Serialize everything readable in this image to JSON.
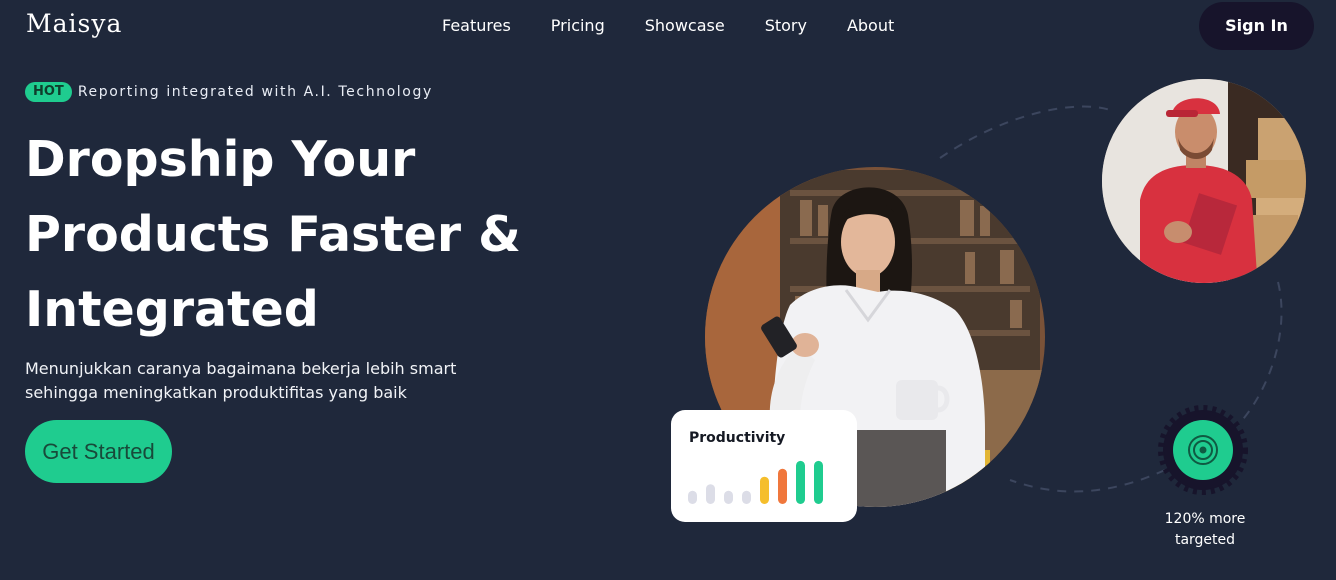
{
  "brand": {
    "logo_text": "Maisya"
  },
  "nav": {
    "items": [
      {
        "label": "Features"
      },
      {
        "label": "Pricing"
      },
      {
        "label": "Showcase"
      },
      {
        "label": "Story"
      },
      {
        "label": "About"
      }
    ],
    "sign_in_label": "Sign In"
  },
  "hero": {
    "badge_label": "HOT",
    "badge_text": "Reporting integrated with A.I. Technology",
    "headline_lines": [
      "Dropship Your",
      "Products Faster &",
      "Integrated"
    ],
    "subtitle_lines": [
      "Menunjukkan caranya bagaimana bekerja lebih smart",
      "sehingga meningkatkan produktifitas yang baik"
    ],
    "cta_label": "Get Started"
  },
  "productivity_card": {
    "title": "Productivity",
    "bars": [
      {
        "value": 0.3,
        "color": "#dcdde7"
      },
      {
        "value": 0.45,
        "color": "#dcdde7"
      },
      {
        "value": 0.3,
        "color": "#dcdde7"
      },
      {
        "value": 0.3,
        "color": "#dcdde7"
      },
      {
        "value": 0.62,
        "color": "#f5be2c"
      },
      {
        "value": 0.8,
        "color": "#f0773c"
      },
      {
        "value": 0.98,
        "color": "#1fcc8f"
      },
      {
        "value": 0.98,
        "color": "#1fcc8f"
      }
    ]
  },
  "stat": {
    "lines": [
      "120% more",
      "targeted"
    ],
    "icon": "target-icon"
  },
  "colors": {
    "background": "#1f283b",
    "accent": "#1fcc8f",
    "sign_in_bg": "#17142b"
  }
}
